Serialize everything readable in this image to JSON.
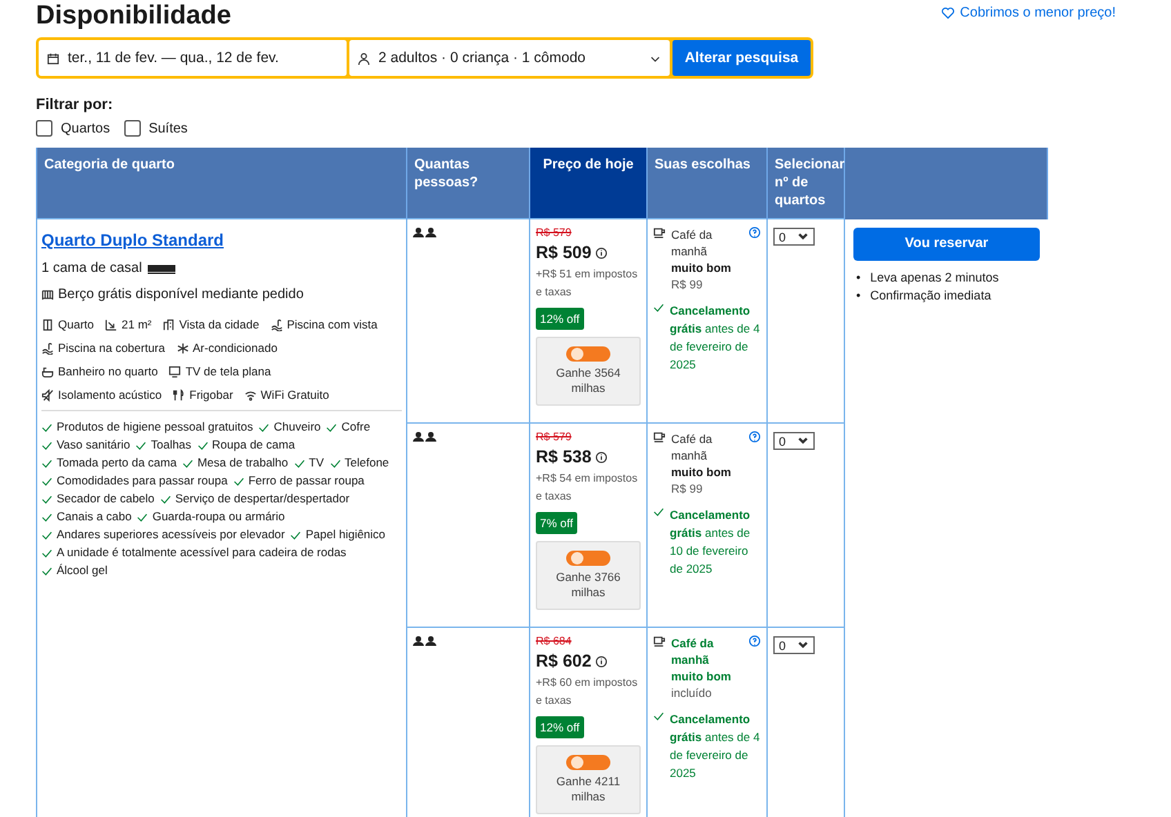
{
  "title": "Disponibilidade",
  "price_match_link": "Cobrimos o menor preço!",
  "search": {
    "checkin": "ter., 11 de fev.",
    "dash": "—",
    "checkout": "qua., 12 de fev.",
    "guests": "2 adultos · 0 criança · 1 cômodo",
    "button": "Alterar pesquisa"
  },
  "filter": {
    "label": "Filtrar por:",
    "options": [
      {
        "label": "Quartos",
        "checked": false
      },
      {
        "label": "Suítes",
        "checked": false
      }
    ]
  },
  "table": {
    "columns": [
      {
        "label": "Categoria de quarto",
        "highlighted": false
      },
      {
        "label": "Quantas pessoas?",
        "highlighted": false
      },
      {
        "label": "Preço de hoje",
        "highlighted": true
      },
      {
        "label": "Suas escolhas",
        "highlighted": false
      },
      {
        "label": "Selecionar nº de quartos",
        "highlighted": false
      }
    ],
    "room": {
      "name": "Quarto Duplo Standard",
      "bed": "1 cama de casal",
      "crib": "Berço grátis disponível mediante pedido",
      "facilities": [
        {
          "kind": "room",
          "text": "Quarto"
        },
        {
          "kind": "size",
          "text": "21 m²"
        },
        {
          "kind": "city",
          "text": "Vista da cidade"
        },
        {
          "kind": "pool",
          "text": "Piscina com vista"
        },
        {
          "kind": "pool",
          "text": "Piscina na cobertura"
        },
        {
          "kind": "ac",
          "text": "Ar-condicionado"
        },
        {
          "kind": "bath",
          "text": "Banheiro no quarto"
        },
        {
          "kind": "tv",
          "text": "TV de tela plana"
        },
        {
          "kind": "sound",
          "text": "Isolamento acústico"
        },
        {
          "kind": "fridge",
          "text": "Frigobar"
        },
        {
          "kind": "wifi",
          "text": "WiFi Gratuito"
        }
      ],
      "amenities": [
        "Produtos de higiene pessoal gratuitos",
        "Chuveiro",
        "Cofre",
        "Vaso sanitário",
        "Toalhas",
        "Roupa de cama",
        "Tomada perto da cama",
        "Mesa de trabalho",
        "TV",
        "Telefone",
        "Comodidades para passar roupa",
        "Ferro de passar roupa",
        "Secador de cabelo",
        "Serviço de despertar/despertador",
        "Canais a cabo",
        "Guarda-roupa ou armário",
        "Andares superiores acessíveis por elevador",
        "Papel higiênico",
        "A unidade é totalmente acessível para cadeira de rodas",
        "Álcool gel"
      ]
    },
    "offers": [
      {
        "old_price": "R$ 579",
        "price": "R$ 509",
        "taxes": "+R$ 51 em impostos e taxas",
        "discount": "12% off",
        "miles": "Ganhe 3564 milhas",
        "breakfast": {
          "text": "Café da manhã **muito bom**",
          "price": "R$ 99",
          "included": false
        },
        "cancellation": "**Cancelamento grátis** antes de 4 de fevereiro de 2025",
        "quantity": "0"
      },
      {
        "old_price": "R$ 579",
        "price": "R$ 538",
        "taxes": "+R$ 54 em impostos e taxas",
        "discount": "7% off",
        "miles": "Ganhe 3766 milhas",
        "breakfast": {
          "text": "Café da manhã **muito bom**",
          "price": "R$ 99",
          "included": false
        },
        "cancellation": "**Cancelamento grátis** antes de 10 de fevereiro de 2025",
        "quantity": "0"
      },
      {
        "old_price": "R$ 684",
        "price": "R$ 602",
        "taxes": "+R$ 60 em impostos e taxas",
        "discount": "12% off",
        "miles": "Ganhe 4211 milhas",
        "breakfast": {
          "text": "Café da manhã muito bom",
          "price": "incluído",
          "included": true
        },
        "cancellation": "**Cancelamento grátis** antes de 4 de fevereiro de 2025",
        "quantity": "0"
      }
    ]
  },
  "reserve": {
    "button": "Vou reservar",
    "points": [
      {
        "bullet": "•",
        "text": "Leva apenas 2 minutos"
      },
      {
        "bullet": "•",
        "text": "Confirmação imediata"
      }
    ]
  }
}
